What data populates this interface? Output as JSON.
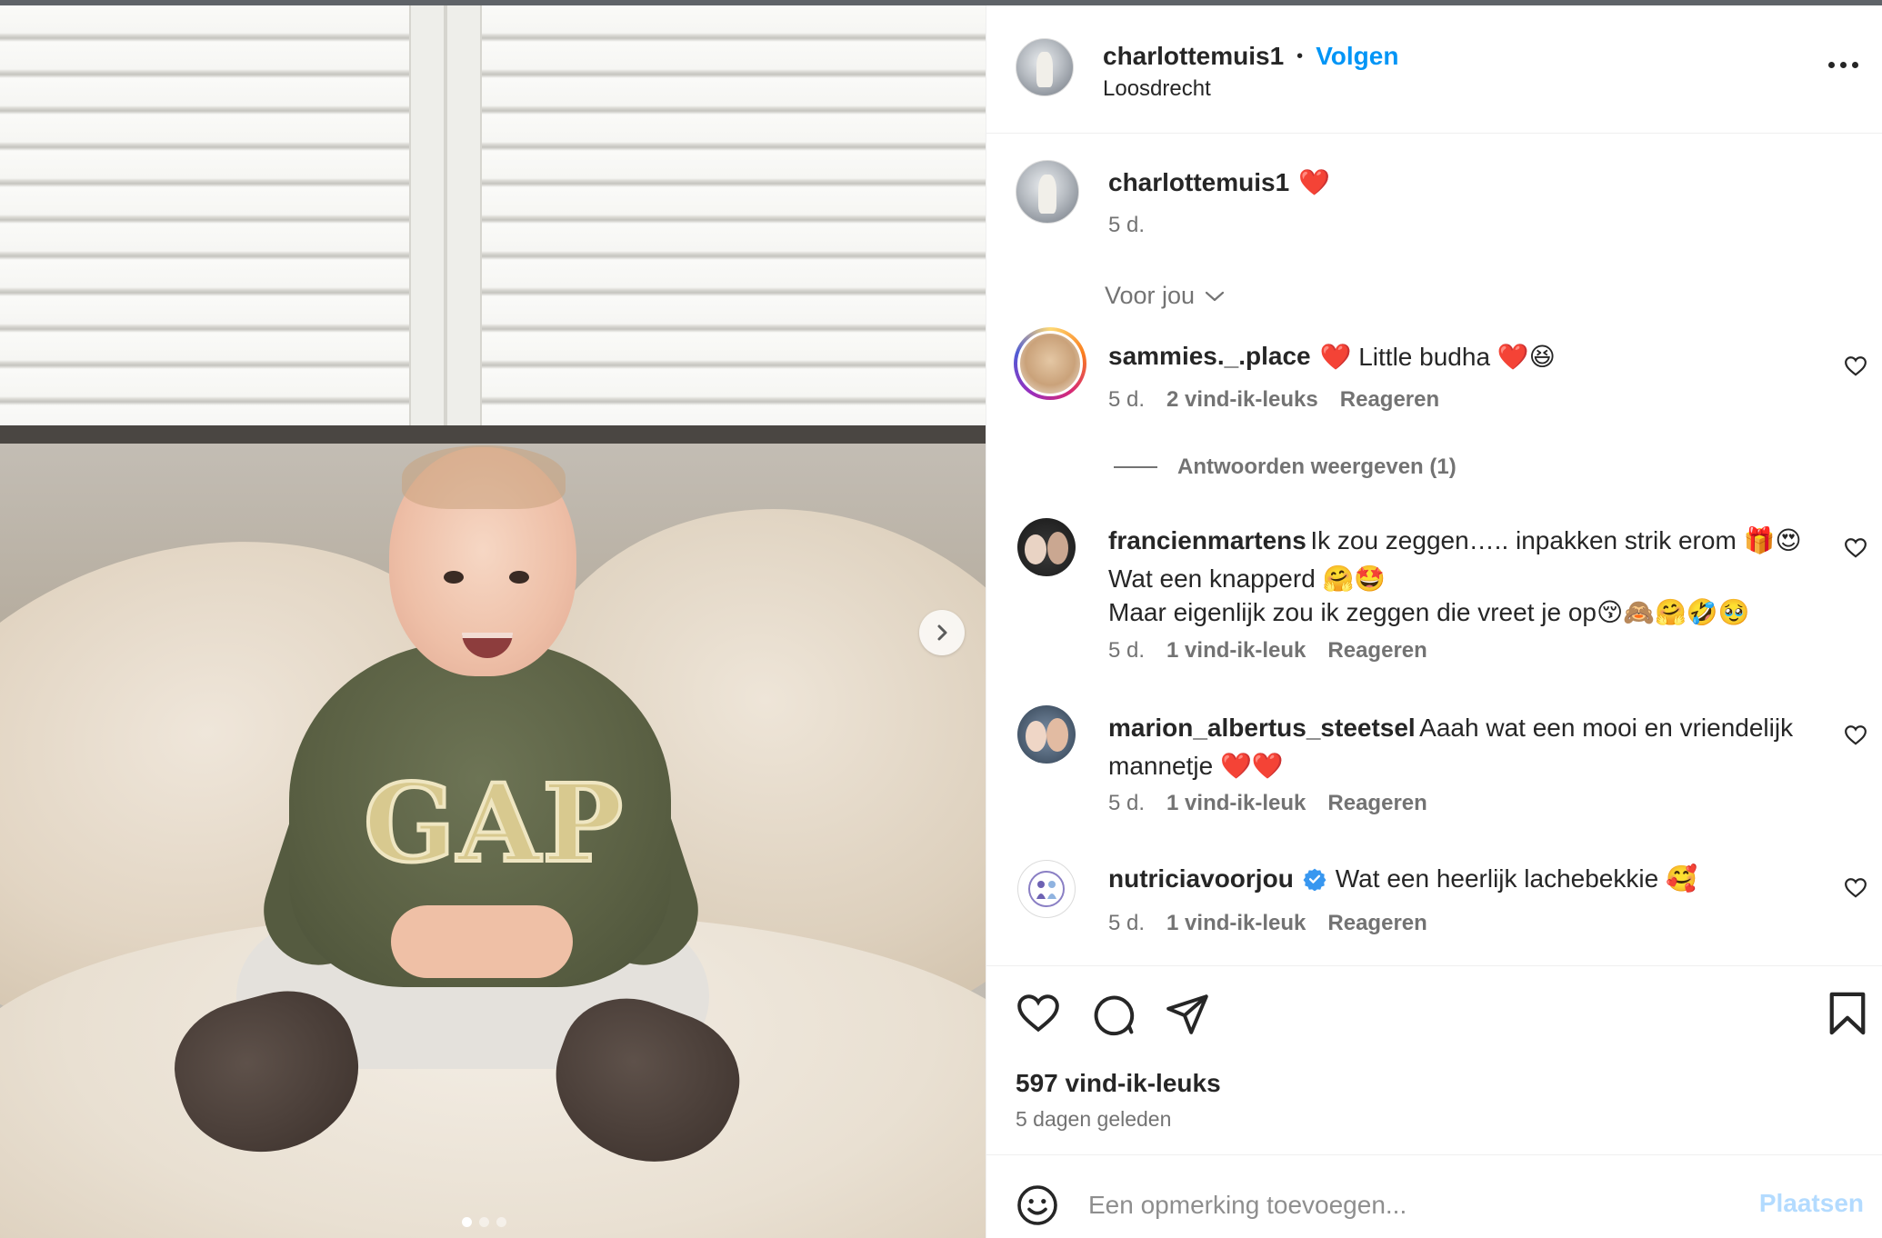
{
  "post": {
    "username": "charlottemuis1",
    "follow_label": "Volgen",
    "separator": "•",
    "location": "Loosdrecht",
    "caption": {
      "username": "charlottemuis1",
      "text": "❤️",
      "time": "5 d."
    },
    "filter_label": "Voor jou",
    "photo": {
      "shirt_text": "GAP",
      "carousel_count": 3,
      "carousel_active": 1
    }
  },
  "comments": [
    {
      "username": "sammies._.place",
      "text": "❤️ Little budha ❤️😆",
      "time": "5 d.",
      "likes": "2 vind-ik-leuks",
      "reply": "Reageren",
      "view_replies": "Antwoorden weergeven (1)"
    },
    {
      "username": "francienmartens",
      "text": "Ik zou zeggen….. inpakken strik erom 🎁😍",
      "text_line2": "Wat een knapperd 🤗🤩",
      "text_line3": "Maar eigenlijk zou ik zeggen die vreet je op😚🙈🤗🤣🥹",
      "time": "5 d.",
      "likes": "1 vind-ik-leuk",
      "reply": "Reageren"
    },
    {
      "username": "marion_albertus_steetsel",
      "text": "Aaah wat een mooi en vriendelijk",
      "text_line2": "mannetje ❤️❤️",
      "time": "5 d.",
      "likes": "1 vind-ik-leuk",
      "reply": "Reageren"
    },
    {
      "username": "nutriciavoorjou",
      "text": "Wat een heerlijk lachebekkie 🥰",
      "time": "5 d.",
      "likes": "1 vind-ik-leuk",
      "reply": "Reageren",
      "verified": true
    }
  ],
  "footer": {
    "likes": "597 vind-ik-leuks",
    "time": "5 dagen geleden",
    "comment_placeholder": "Een opmerking toevoegen...",
    "post_label": "Plaatsen"
  },
  "colors": {
    "accent": "#0095f6",
    "post_disabled": "#b3dbff",
    "muted": "#737373",
    "verified": "#3897f0"
  },
  "icons": {
    "more": "more-options-icon",
    "next": "chevron-right-icon",
    "like": "heart-icon",
    "comment": "comment-bubble-icon",
    "share": "paper-plane-icon",
    "save": "bookmark-icon",
    "emoji": "smiley-icon",
    "filter": "chevron-down-icon"
  }
}
